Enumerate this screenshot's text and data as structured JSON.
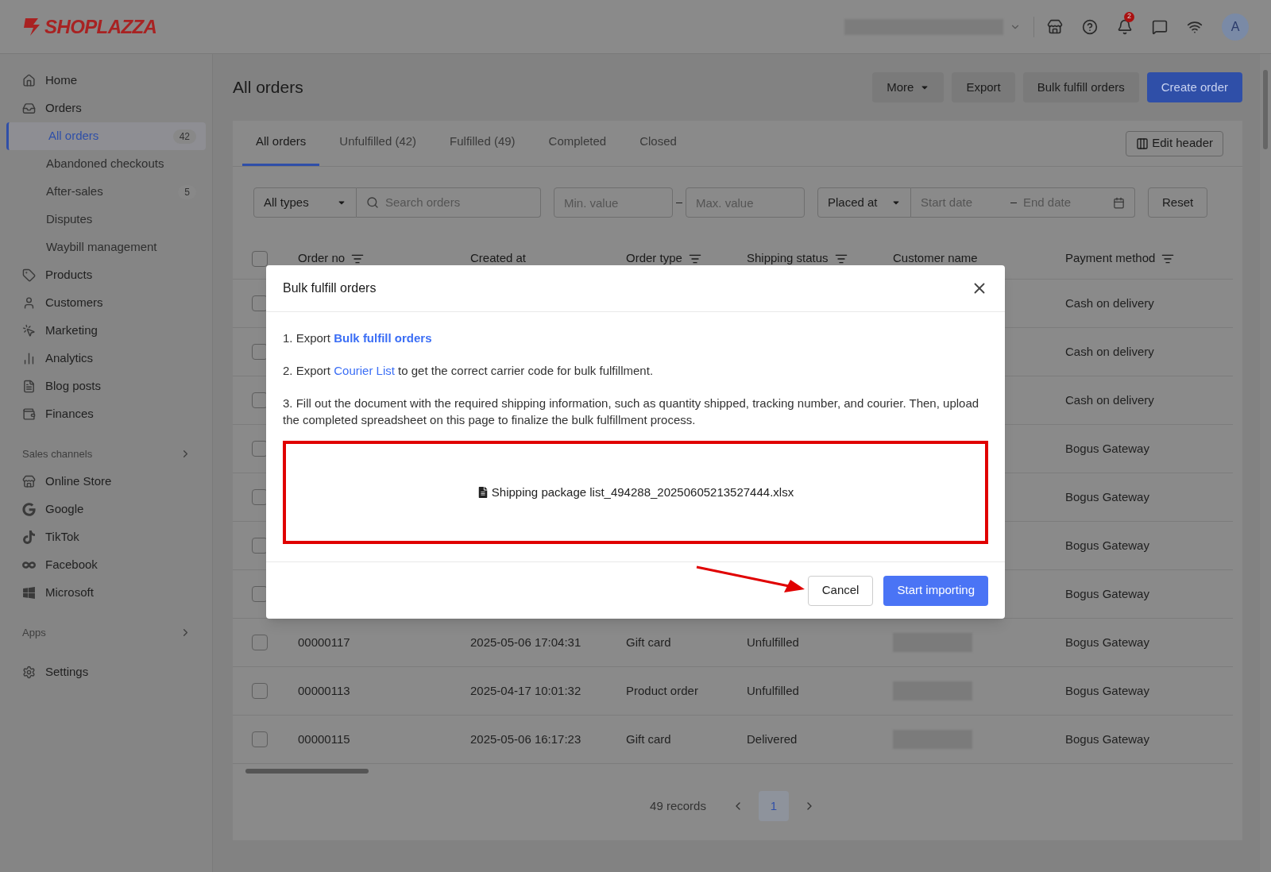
{
  "header": {
    "logo": "SHOPLAZZA",
    "notification_count": "2",
    "avatar": "A"
  },
  "sidebar": {
    "main": [
      {
        "label": "Home",
        "selected": false
      },
      {
        "label": "Orders",
        "selected": false,
        "expanded": true,
        "children": [
          {
            "label": "All orders",
            "count": "42",
            "selected": true
          },
          {
            "label": "Abandoned checkouts",
            "selected": false
          },
          {
            "label": "After-sales",
            "count": "5",
            "selected": false
          },
          {
            "label": "Disputes",
            "selected": false
          },
          {
            "label": "Waybill management",
            "selected": false
          }
        ]
      },
      {
        "label": "Products",
        "selected": false
      },
      {
        "label": "Customers",
        "selected": false
      },
      {
        "label": "Marketing",
        "selected": false
      },
      {
        "label": "Analytics",
        "selected": false
      },
      {
        "label": "Blog posts",
        "selected": false
      },
      {
        "label": "Finances",
        "selected": false
      }
    ],
    "sales_channels": {
      "title": "Sales channels",
      "items": [
        {
          "label": "Online Store"
        },
        {
          "label": "Google"
        },
        {
          "label": "TikTok"
        },
        {
          "label": "Facebook"
        },
        {
          "label": "Microsoft"
        }
      ]
    },
    "apps": {
      "title": "Apps"
    },
    "settings": {
      "label": "Settings"
    }
  },
  "page": {
    "title": "All orders",
    "actions": [
      {
        "label": "More",
        "kind": "menu"
      },
      {
        "label": "Export",
        "kind": "plain"
      },
      {
        "label": "Bulk fulfill orders",
        "kind": "plain"
      },
      {
        "label": "Create order",
        "kind": "primary"
      }
    ]
  },
  "tabs": [
    {
      "label": "All orders",
      "selected": true
    },
    {
      "label": "Unfulfilled (42)",
      "selected": false
    },
    {
      "label": "Fulfilled (49)",
      "selected": false
    },
    {
      "label": "Completed",
      "selected": false
    },
    {
      "label": "Closed",
      "selected": false
    }
  ],
  "edit_header": "Edit header",
  "filters": {
    "type": "All types",
    "search": {
      "placeholder": "Search orders"
    },
    "min": {
      "placeholder": "Min. value"
    },
    "max": {
      "placeholder": "Max. value"
    },
    "date_type": "Placed at",
    "start": {
      "placeholder": "Start date"
    },
    "end": {
      "placeholder": "End date"
    },
    "reset": "Reset"
  },
  "table": {
    "select_all_checked": false,
    "columns": [
      {
        "label": "Order no",
        "filter": true
      },
      {
        "label": "Created at",
        "filter": false
      },
      {
        "label": "Order type",
        "filter": true
      },
      {
        "label": "Shipping status",
        "filter": true
      },
      {
        "label": "Customer name",
        "filter": false
      },
      {
        "label": "Payment method",
        "filter": true
      }
    ],
    "rows": [
      {
        "checked": false,
        "payment": "Cash on delivery"
      },
      {
        "checked": false,
        "payment": "Cash on delivery"
      },
      {
        "checked": false,
        "payment": "Cash on delivery"
      },
      {
        "checked": false,
        "payment": "Bogus Gateway"
      },
      {
        "checked": false,
        "payment": "Bogus Gateway"
      },
      {
        "checked": false,
        "payment": "Bogus Gateway"
      },
      {
        "checked": false,
        "payment": "Bogus Gateway"
      },
      {
        "checked": false,
        "order_no": "00000117",
        "created": "2025-05-06 17:04:31",
        "type": "Gift card",
        "status": "Unfulfilled",
        "payment": "Bogus Gateway"
      },
      {
        "checked": false,
        "order_no": "00000113",
        "created": "2025-04-17 10:01:32",
        "type": "Product order",
        "status": "Unfulfilled",
        "payment": "Bogus Gateway"
      },
      {
        "checked": false,
        "order_no": "00000115",
        "created": "2025-05-06 16:17:23",
        "type": "Gift card",
        "status": "Delivered",
        "payment": "Bogus Gateway"
      }
    ]
  },
  "pagination": {
    "records": "49 records",
    "pages": [
      {
        "label": "1",
        "selected": true
      }
    ]
  },
  "dialog": {
    "title": "Bulk fulfill orders",
    "steps": [
      {
        "prefix": "1. Export ",
        "link": "Bulk fulfill orders",
        "link_bold": true
      },
      {
        "prefix": "2. Export ",
        "link": "Courier List",
        "suffix": " to get the correct carrier code for bulk fulfillment.",
        "link_bold": false
      },
      {
        "prefix": "3. Fill out the document with the required shipping information, such as quantity shipped, tracking number, and courier. Then, upload the completed spreadsheet on this page to finalize the bulk fulfillment process."
      }
    ],
    "file": "Shipping package list_494288_20250605213527444.xlsx",
    "buttons": [
      {
        "label": "Cancel",
        "kind": "secondary"
      },
      {
        "label": "Start importing",
        "kind": "primary"
      }
    ]
  }
}
